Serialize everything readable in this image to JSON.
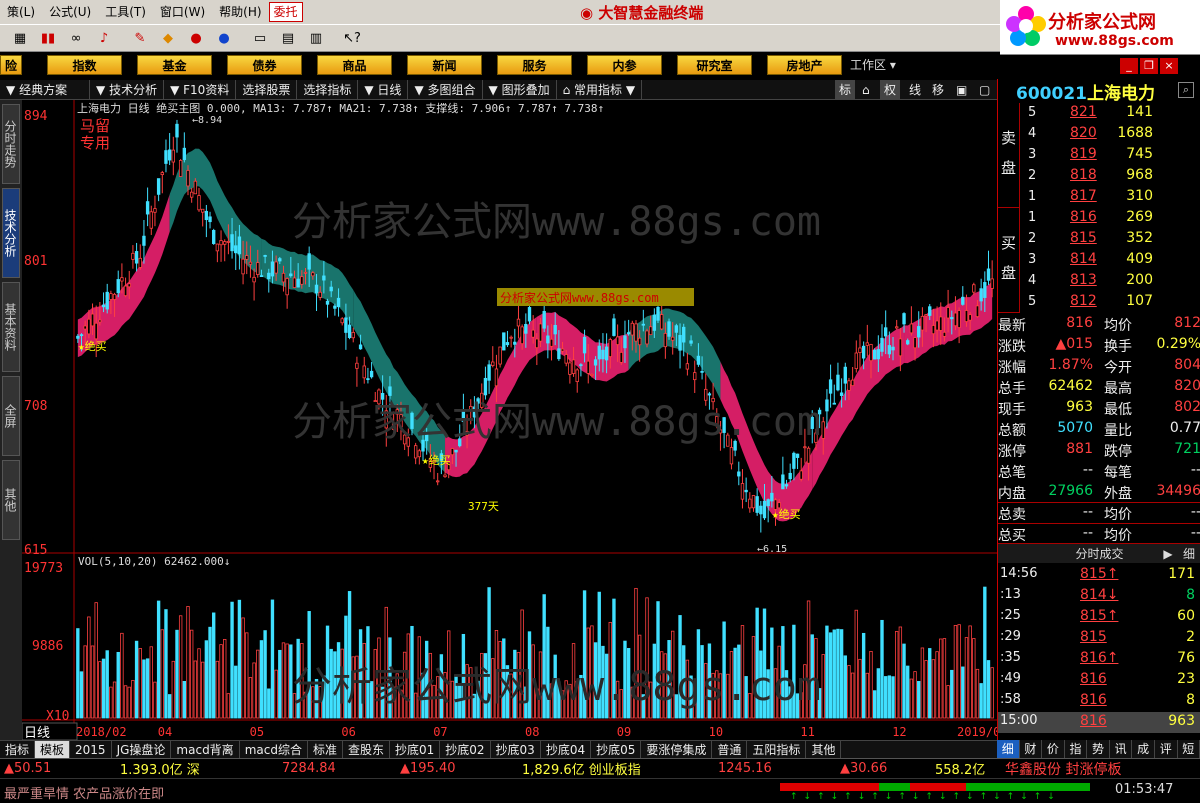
{
  "menubar": {
    "items": [
      "策(L)",
      "公式(U)",
      "工具(T)",
      "窗口(W)",
      "帮助(H)"
    ],
    "active_item": "委托",
    "app_title": "大智慧金融终端"
  },
  "logo": {
    "line1": "分析家公式网",
    "line2": "www.88gs.com"
  },
  "nav": {
    "buttons": [
      "指数",
      "基金",
      "债券",
      "商品",
      "新闻",
      "服务",
      "内参",
      "研究室",
      "房地产"
    ],
    "first_partial": "险",
    "workarea": "工作区"
  },
  "submenu": {
    "items": [
      "经典方案",
      "技术分析",
      "F10资料",
      "选择股票",
      "选择指标",
      "日线",
      "多图组合",
      "图形叠加",
      "常用指标"
    ],
    "right_buttons": [
      "标",
      "权",
      "线",
      "移"
    ]
  },
  "sidebar": {
    "tabs": [
      "分时走势",
      "技术分析",
      "基本资料",
      "全屏",
      "其他"
    ],
    "active_tab": "技术分析"
  },
  "chart": {
    "header": "上海电力 日线  绝买主图 0.000, MA13: 7.787↑  MA21: 7.738↑ 支撑线: 7.906↑ 7.787↑ 7.738↑",
    "watermark": "分析家公式网www.88gs.com",
    "watermark_small": "分析家公式网www.88gs.com",
    "badge": "马留专用",
    "high_label": "8.94",
    "low_label": "6.15",
    "buy_label": "★绝买",
    "days_label": "377天",
    "vol_header": "VOL(5,10,20)  62462.000↓",
    "period_label": "日线",
    "y_price_ticks": [
      "894",
      "801",
      "708",
      "615"
    ],
    "y_vol_ticks": [
      "19773",
      "9886",
      "X10"
    ],
    "x_months": [
      "2018/02",
      "04",
      "05",
      "06",
      "07",
      "08",
      "09",
      "10",
      "11",
      "12",
      "2019/01"
    ]
  },
  "chart_data": {
    "type": "candlestick",
    "title": "上海电力 日线",
    "ylim": [
      6.15,
      8.94
    ],
    "y_ticks_printed": [
      "894",
      "801",
      "708",
      "615"
    ],
    "high": 8.94,
    "low": 6.15,
    "ma13": 7.787,
    "ma21": 7.738,
    "support_lines": [
      7.906,
      7.787,
      7.738
    ],
    "volume_ylim": [
      0,
      19773
    ],
    "volume_last": 62462
  },
  "quote": {
    "code": "600021",
    "name": "上海电力",
    "sell_label": [
      "卖",
      "盘"
    ],
    "buy_label": [
      "买",
      "盘"
    ],
    "sells": [
      {
        "n": "5",
        "price": "821",
        "vol": "141"
      },
      {
        "n": "4",
        "price": "820",
        "vol": "1688"
      },
      {
        "n": "3",
        "price": "819",
        "vol": "745"
      },
      {
        "n": "2",
        "price": "818",
        "vol": "968"
      },
      {
        "n": "1",
        "price": "817",
        "vol": "310"
      }
    ],
    "buys": [
      {
        "n": "1",
        "price": "816",
        "vol": "269"
      },
      {
        "n": "2",
        "price": "815",
        "vol": "352"
      },
      {
        "n": "3",
        "price": "814",
        "vol": "409"
      },
      {
        "n": "4",
        "price": "813",
        "vol": "200"
      },
      {
        "n": "5",
        "price": "812",
        "vol": "107"
      }
    ],
    "stats": [
      {
        "k1": "最新",
        "v1": "816",
        "k2": "均价",
        "v2": "812",
        "c1": "red",
        "c2": "red"
      },
      {
        "k1": "涨跌",
        "v1": "▲015",
        "k2": "换手",
        "v2": "0.29%",
        "c1": "red",
        "c2": "yellow"
      },
      {
        "k1": "涨幅",
        "v1": "1.87%",
        "k2": "今开",
        "v2": "804",
        "c1": "red",
        "c2": "red"
      },
      {
        "k1": "总手",
        "v1": "62462",
        "k2": "最高",
        "v2": "820",
        "c1": "yellow",
        "c2": "red"
      },
      {
        "k1": "现手",
        "v1": "963",
        "k2": "最低",
        "v2": "802",
        "c1": "yellow",
        "c2": "red"
      },
      {
        "k1": "总额",
        "v1": "5070",
        "k2": "量比",
        "v2": "0.77",
        "c1": "cyan",
        "c2": "white"
      },
      {
        "k1": "涨停",
        "v1": "881",
        "k2": "跌停",
        "v2": "721",
        "c1": "red",
        "c2": "green"
      },
      {
        "k1": "总笔",
        "v1": "--",
        "k2": "每笔",
        "v2": "--",
        "c1": "white",
        "c2": "white"
      },
      {
        "k1": "内盘",
        "v1": "27966",
        "k2": "外盘",
        "v2": "34496",
        "c1": "green",
        "c2": "red"
      },
      {
        "k1": "总卖",
        "v1": "--",
        "k2": "均价",
        "v2": "--",
        "c1": "white",
        "c2": "white"
      },
      {
        "k1": "总买",
        "v1": "--",
        "k2": "均价",
        "v2": "--",
        "c1": "white",
        "c2": "white"
      }
    ],
    "ticks_title": "分时成交",
    "ticks_btn": "细",
    "ticks": [
      {
        "t": "14:56",
        "p": "815↑",
        "v": "171"
      },
      {
        "t": ":13",
        "p": "814↓",
        "v": "8"
      },
      {
        "t": ":25",
        "p": "815↑",
        "v": "60"
      },
      {
        "t": ":29",
        "p": "815",
        "v": "2"
      },
      {
        "t": ":35",
        "p": "816↑",
        "v": "76"
      },
      {
        "t": ":49",
        "p": "816",
        "v": "23"
      },
      {
        "t": ":58",
        "p": "816",
        "v": "8"
      },
      {
        "t": "15:00",
        "p": "816",
        "v": "963"
      }
    ]
  },
  "tabs": [
    "指标",
    "模板",
    "2015",
    "JG操盘论",
    "macd背离",
    "macd综合",
    "标准",
    "查股东",
    "抄底01",
    "抄底02",
    "抄底03",
    "抄底04",
    "抄底05",
    "要涨停集成",
    "普通",
    "五阳指标",
    "其他"
  ],
  "active_tab": "模板",
  "right_tabs": [
    "细",
    "财",
    "价",
    "指",
    "势",
    "讯",
    "成",
    "评",
    "短"
  ],
  "index_bar": {
    "a": "▲50.51",
    "b": "1.393.0亿 深",
    "c": "7284.84",
    "d": "▲195.40",
    "e": "1,829.6亿 创业板指",
    "f": "1245.16",
    "g": "▲30.66",
    "h": "558.2亿",
    "i": "华鑫股份 封涨停板"
  },
  "ticker": {
    "text": "最严重旱情 农产品涨价在即",
    "time": "01:53:47"
  }
}
